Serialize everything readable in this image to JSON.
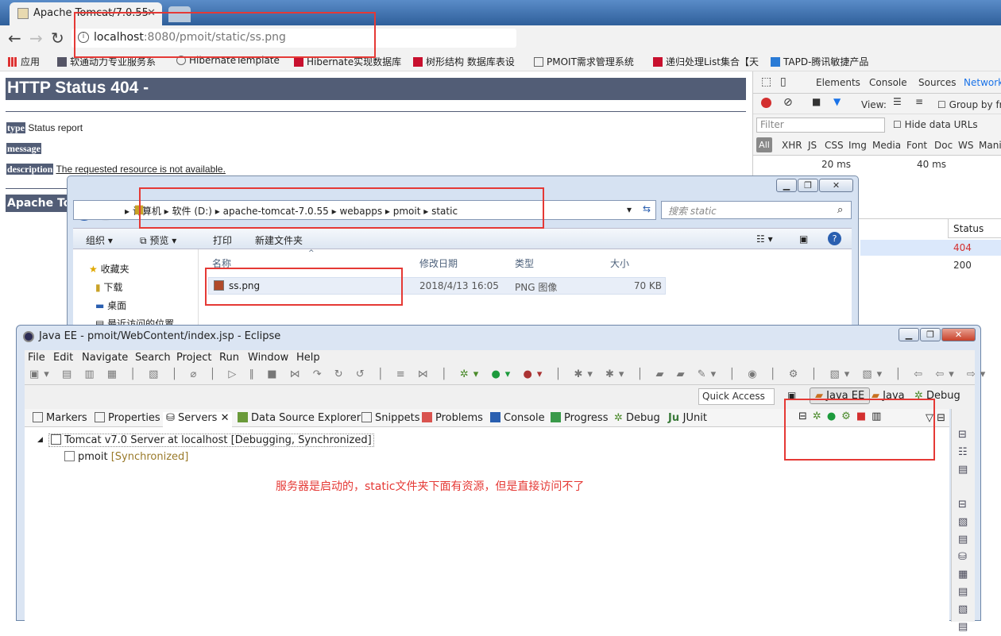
{
  "browser": {
    "tab_title": "Apache Tomcat/7.0.55",
    "url_host": "localhost",
    "url_path": ":8080/pmoit/static/ss.png",
    "bookmarks": [
      "应用",
      "软通动力专业服务系",
      "HibernateTemplate",
      "Hibernate实现数据库",
      "树形结构 数据库表设",
      "PMOIT需求管理系统",
      "递归处理List集合【天",
      "TAPD-腾讯敏捷产品"
    ]
  },
  "page": {
    "heading": "HTTP Status 404 -",
    "type_label": "type",
    "type_value": "Status report",
    "message_label": "message",
    "description_label": "description",
    "description_value": "The requested resource is not available.",
    "footer": "Apache To"
  },
  "devtools": {
    "tabs": [
      "Elements",
      "Console",
      "Sources",
      "Network"
    ],
    "view_label": "View:",
    "group_label": "Group by fr",
    "filter_placeholder": "Filter",
    "hide_data_urls": "Hide data URLs",
    "types": [
      "All",
      "XHR",
      "JS",
      "CSS",
      "Img",
      "Media",
      "Font",
      "Doc",
      "WS",
      "Mani"
    ],
    "timeline": [
      "20 ms",
      "40 ms"
    ],
    "status_header": "Status",
    "status_values": [
      "404",
      "200"
    ]
  },
  "explorer": {
    "breadcrumb": [
      "计算机",
      "软件 (D:)",
      "apache-tomcat-7.0.55",
      "webapps",
      "pmoit",
      "static"
    ],
    "search_placeholder": "搜索 static",
    "commands": [
      "组织 ▾",
      "预览 ▾",
      "打印",
      "新建文件夹"
    ],
    "nav_items": [
      "收藏夹",
      "下载",
      "桌面",
      "最近访问的位置"
    ],
    "columns": [
      "名称",
      "修改日期",
      "类型",
      "大小"
    ],
    "file": {
      "name": "ss.png",
      "date": "2018/4/13 16:05",
      "type": "PNG 图像",
      "size": "70 KB"
    }
  },
  "eclipse": {
    "title": "Java EE - pmoit/WebContent/index.jsp - Eclipse",
    "menu": [
      "File",
      "Edit",
      "Navigate",
      "Search",
      "Project",
      "Run",
      "Window",
      "Help"
    ],
    "quick_access": "Quick Access",
    "perspectives": [
      "Java EE",
      "Java",
      "Debug"
    ],
    "views": [
      "Markers",
      "Properties",
      "Servers",
      "Data Source Explorer",
      "Snippets",
      "Problems",
      "Console",
      "Progress",
      "Debug",
      "JUnit"
    ],
    "server": "Tomcat v7.0 Server at localhost  [Debugging, Synchronized]",
    "module": "pmoit",
    "module_status": "[Synchronized]",
    "annotation": "服务器是启动的，static文件夹下面有资源，但是直接访问不了"
  },
  "colors": {
    "tomcat_bar": "#525d76",
    "annotation_red": "#e53935",
    "status_404": "#d32f2f"
  }
}
